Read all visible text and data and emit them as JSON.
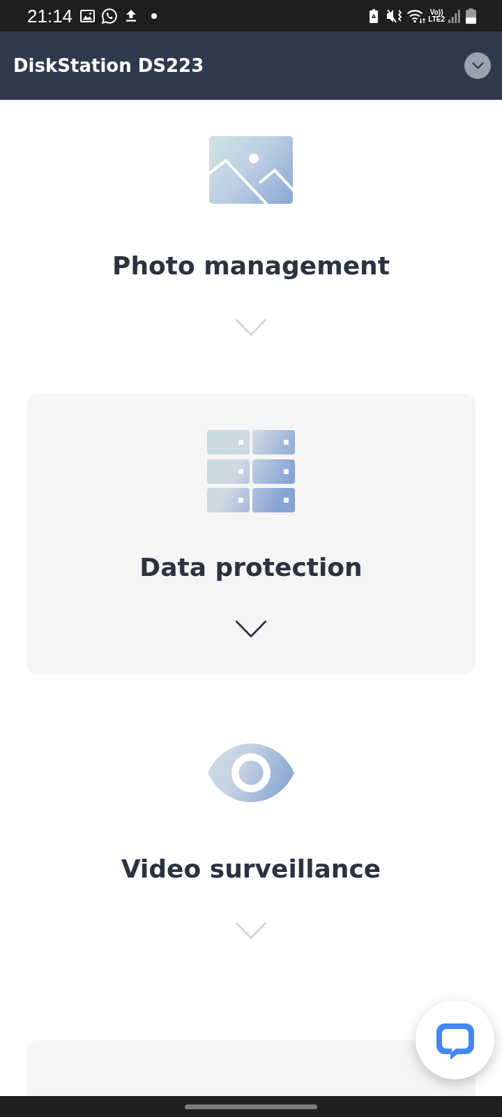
{
  "status_bar": {
    "time": "21:14",
    "network_labels": [
      "Vo))",
      "LTE2"
    ]
  },
  "header": {
    "title": "DiskStation DS223"
  },
  "sections": [
    {
      "kind": "photo",
      "title": "Photo management",
      "selected": false
    },
    {
      "kind": "storage",
      "title": "Data protection",
      "selected": true
    },
    {
      "kind": "video",
      "title": "Video surveillance",
      "selected": false
    },
    {
      "kind": "partial",
      "selected": true
    }
  ]
}
